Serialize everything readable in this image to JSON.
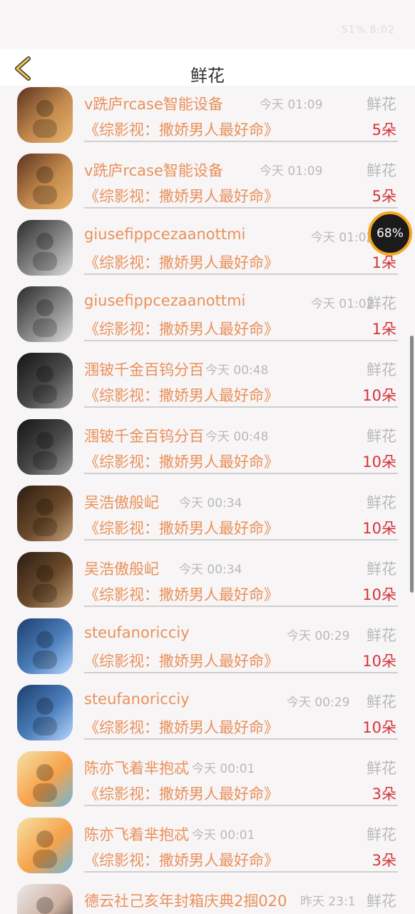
{
  "status_bar": {
    "text": "51% 8:02"
  },
  "header": {
    "title": "鲜花"
  },
  "overlay": {
    "battery_badge": "68%"
  },
  "rows": [
    {
      "name": "v跣庐rcase智能设备",
      "time": "今天 01:09",
      "tag": "鲜花",
      "show": "《综影视：撒娇男人最好命》",
      "count": "5朵",
      "avatar": "warm-photo"
    },
    {
      "name": "v跣庐rcase智能设备",
      "time": "今天 01:09",
      "tag": "鲜花",
      "show": "《综影视：撒娇男人最好命》",
      "count": "5朵",
      "avatar": "warm-photo"
    },
    {
      "name": "giusefippcezaanottmi",
      "time": "今天 01:02",
      "tag": "鲜花",
      "show": "《综影视：撒娇男人最好命》",
      "count": "1朵",
      "avatar": "gray-photo"
    },
    {
      "name": "giusefippcezaanottmi",
      "time": "今天 01:02",
      "tag": "鲜花",
      "show": "《综影视：撒娇男人最好命》",
      "count": "1朵",
      "avatar": "gray-photo"
    },
    {
      "name": "涠铍千金百钨分百",
      "time": "今天 00:48",
      "tag": "鲜花",
      "show": "《综影视：撒娇男人最好命》",
      "count": "10朵",
      "avatar": "dark-photo"
    },
    {
      "name": "涠铍千金百钨分百",
      "time": "今天 00:48",
      "tag": "鲜花",
      "show": "《综影视：撒娇男人最好命》",
      "count": "10朵",
      "avatar": "dark-photo"
    },
    {
      "name": "吴浩傲般屺",
      "time": "今天 00:34",
      "tag": "鲜花",
      "show": "《综影视：撒娇男人最好命》",
      "count": "10朵",
      "avatar": "brown-photo"
    },
    {
      "name": "吴浩傲般屺",
      "time": "今天 00:34",
      "tag": "鲜花",
      "show": "《综影视：撒娇男人最好命》",
      "count": "10朵",
      "avatar": "brown-photo"
    },
    {
      "name": "steufanoricciy",
      "time": "今天 00:29",
      "tag": "鲜花",
      "show": "《综影视：撒娇男人最好命》",
      "count": "10朵",
      "avatar": "blue-photo"
    },
    {
      "name": "steufanoricciy",
      "time": "今天 00:29",
      "tag": "鲜花",
      "show": "《综影视：撒娇男人最好命》",
      "count": "10朵",
      "avatar": "blue-photo"
    },
    {
      "name": "陈亦飞着芈抱忒",
      "time": "今天 00:01",
      "tag": "鲜花",
      "show": "《综影视：撒娇男人最好命》",
      "count": "3朵",
      "avatar": "balloon-photo"
    },
    {
      "name": "陈亦飞着芈抱忒",
      "time": "今天 00:01",
      "tag": "鲜花",
      "show": "《综影视：撒娇男人最好命》",
      "count": "3朵",
      "avatar": "balloon-photo"
    },
    {
      "name": "德云社己亥年封箱庆典2掴020",
      "time": "昨天 23:1",
      "tag": "鲜花",
      "show": "",
      "count": "",
      "avatar": "portrait-photo"
    }
  ]
}
